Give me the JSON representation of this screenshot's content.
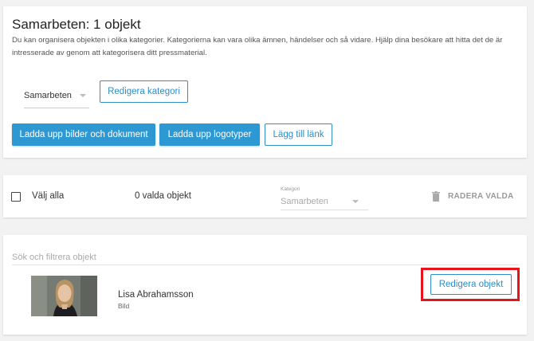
{
  "header": {
    "title": "Samarbeten: 1 objekt",
    "description": "Du kan organisera objekten i olika kategorier. Kategorierna kan vara olika ämnen, händelser och så vidare. Hjälp dina besökare att hitta det de är intresserade av genom att kategorisera ditt pressmaterial."
  },
  "category_dropdown": {
    "value": "Samarbeten"
  },
  "buttons": {
    "edit_category": "Redigera kategori",
    "upload_files": "Ladda upp bilder och dokument",
    "upload_logos": "Ladda upp logotyper",
    "add_link": "Lägg till länk"
  },
  "selection_bar": {
    "select_all": "Välj alla",
    "selected_count": "0 valda objekt",
    "category_label": "Kategori",
    "category_value": "Samarbeten",
    "delete_selected": "RADERA VALDA"
  },
  "list": {
    "search_placeholder": "Sök och filtrera objekt",
    "items": [
      {
        "name": "Lisa Abrahamsson",
        "type": "Bild",
        "edit_label": "Redigera objekt"
      }
    ]
  },
  "colors": {
    "primary": "#2d98d2",
    "highlight": "#e8141b"
  }
}
